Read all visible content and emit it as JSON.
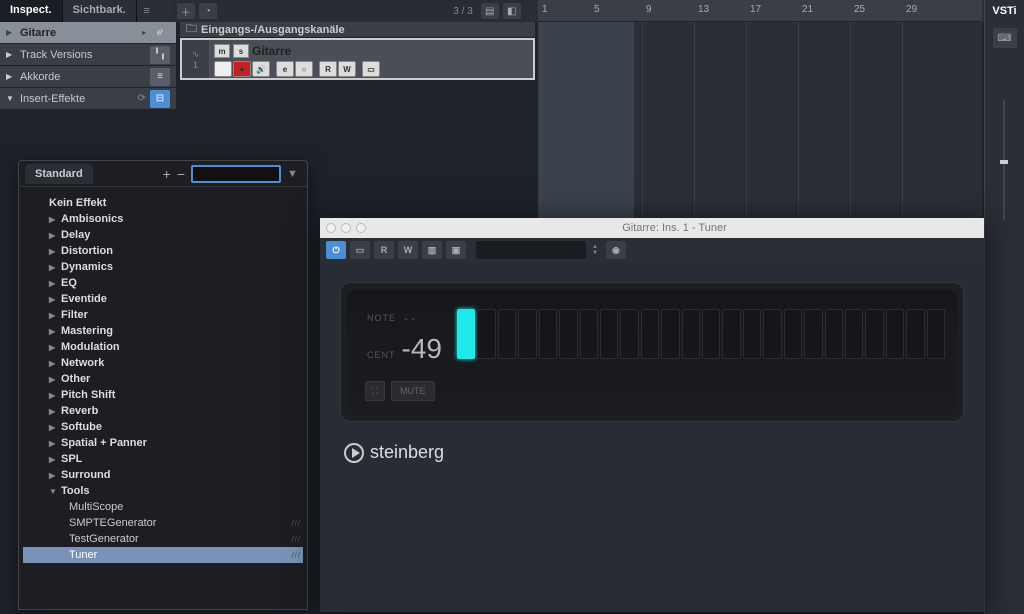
{
  "topbar": {
    "tabs": [
      "Inspect.",
      "Sichtbark."
    ],
    "track_count": "3 / 3"
  },
  "inspector": {
    "track_name": "Gitarre",
    "sections": {
      "track_versions": "Track Versions",
      "chords": "Akkorde",
      "inserts": "Insert-Effekte"
    }
  },
  "tracklist": {
    "folder_label": "Eingangs-/Ausgangskanäle",
    "track1": {
      "number": "1",
      "name": "Gitarre",
      "buttons": {
        "m": "m",
        "s": "s",
        "e": "e",
        "r": "R",
        "w": "W"
      }
    }
  },
  "ruler": {
    "marks": [
      {
        "pos": 0,
        "label": "1"
      },
      {
        "pos": 52,
        "label": "5"
      },
      {
        "pos": 104,
        "label": "9"
      },
      {
        "pos": 156,
        "label": "13"
      },
      {
        "pos": 208,
        "label": "17"
      },
      {
        "pos": 260,
        "label": "21"
      },
      {
        "pos": 312,
        "label": "25"
      },
      {
        "pos": 364,
        "label": "29"
      }
    ]
  },
  "right_panel": {
    "tab": "VSTi"
  },
  "plugin_browser": {
    "tab": "Standard",
    "no_effect": "Kein Effekt",
    "categories": [
      "Ambisonics",
      "Delay",
      "Distortion",
      "Dynamics",
      "EQ",
      "Eventide",
      "Filter",
      "Mastering",
      "Modulation",
      "Network",
      "Other",
      "Pitch Shift",
      "Reverb",
      "Softube",
      "Spatial + Panner",
      "SPL",
      "Surround"
    ],
    "tools_label": "Tools",
    "tools_children": [
      "MultiScope",
      "SMPTEGenerator",
      "TestGenerator",
      "Tuner"
    ],
    "selected": "Tuner"
  },
  "plugin_window": {
    "title": "Gitarre: Ins. 1 - Tuner",
    "toolbar": {
      "r": "R",
      "w": "W"
    },
    "tuner": {
      "note_label": "NOTE",
      "note_value": "--",
      "cent_label": "CENT",
      "cent_value": "-49",
      "mute": "MUTE"
    },
    "brand": "steinberg"
  }
}
